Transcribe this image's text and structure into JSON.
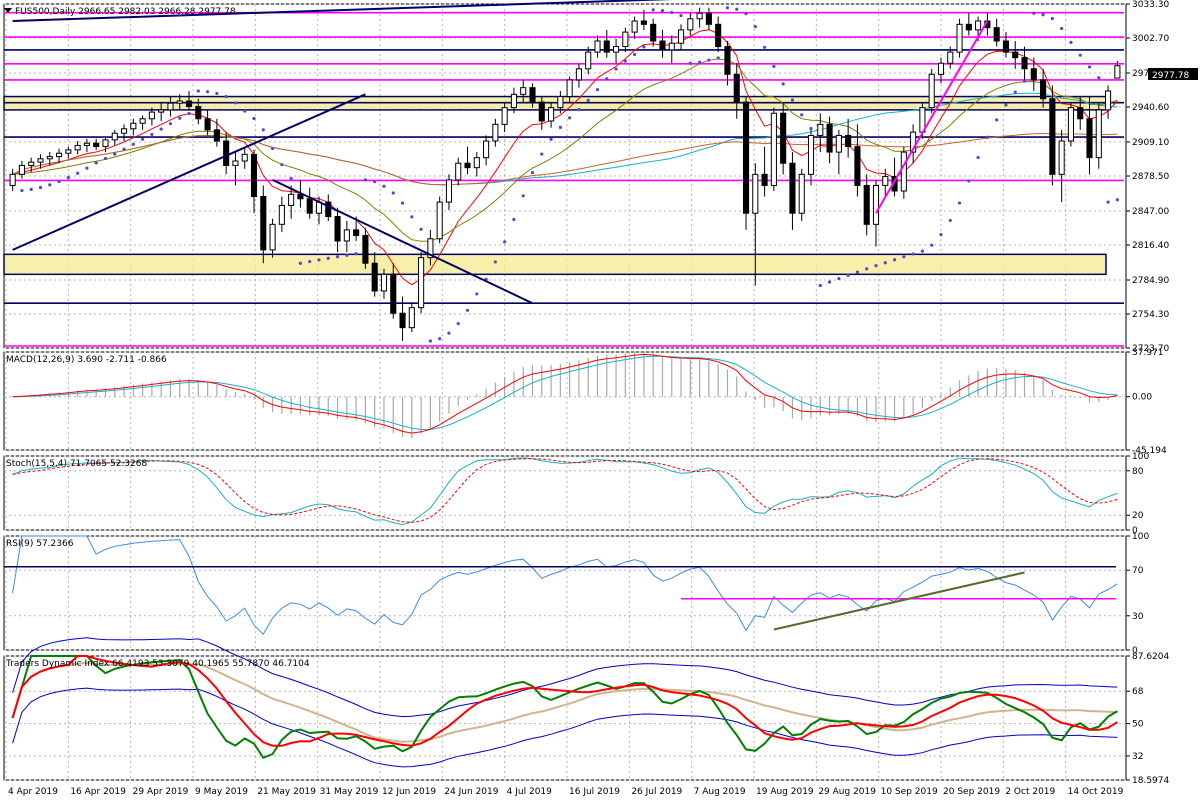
{
  "window": {
    "icon": "triangle-down-icon",
    "symbol_line": "FUS500,Daily  2966.65 2982.03 2966.28 2977.78",
    "last_price": "2977.78"
  },
  "colors": {
    "background": "#ffffff",
    "grid": "#b4b4b4",
    "candle": "#000000",
    "navy": "#000066",
    "magenta": "#ff00ff",
    "sar": "#4b4bd8",
    "zone": "#f5ea8e",
    "red": "#ff0000",
    "cyan": "#1ab0c8",
    "olive": "#808000",
    "tan": "#d2b48c",
    "green": "#008000",
    "blue": "#0000cc",
    "hist": "#a8a8a8",
    "price_box": "#000000"
  },
  "chart_data": [
    {
      "type": "candlestick",
      "title": "FUS500,Daily  2966.65 2982.03 2966.28 2977.78",
      "ylim": [
        2723.7,
        3033.3
      ],
      "y_ticks": [
        "3033.30",
        "3002.70",
        "2971.20",
        "2940.60",
        "2909.10",
        "2878.50",
        "2847.00",
        "2816.40",
        "2784.90",
        "2754.30",
        "2723.70"
      ],
      "x_labels": [
        "4 Apr 2019",
        "16 Apr 2019",
        "29 Apr 2019",
        "9 May 2019",
        "21 May 2019",
        "31 May 2019",
        "12 Jun 2019",
        "24 Jun 2019",
        "4 Jul 2019",
        "16 Jul 2019",
        "26 Jul 2019",
        "7 Aug 2019",
        "19 Aug 2019",
        "29 Aug 2019",
        "10 Sep 2019",
        "20 Sep 2019",
        "2 Oct 2019",
        "14 Oct 2019"
      ],
      "last_close": 2977.78,
      "candles": [
        [
          2870,
          2885,
          2865,
          2880
        ],
        [
          2880,
          2892,
          2876,
          2888
        ],
        [
          2888,
          2895,
          2882,
          2891
        ],
        [
          2891,
          2898,
          2885,
          2894
        ],
        [
          2894,
          2900,
          2888,
          2896
        ],
        [
          2896,
          2903,
          2890,
          2899
        ],
        [
          2899,
          2905,
          2894,
          2902
        ],
        [
          2902,
          2910,
          2898,
          2906
        ],
        [
          2906,
          2912,
          2900,
          2908
        ],
        [
          2908,
          2912,
          2902,
          2905
        ],
        [
          2905,
          2914,
          2900,
          2911
        ],
        [
          2911,
          2920,
          2906,
          2917
        ],
        [
          2917,
          2925,
          2910,
          2921
        ],
        [
          2921,
          2930,
          2915,
          2926
        ],
        [
          2926,
          2933,
          2920,
          2930
        ],
        [
          2930,
          2940,
          2924,
          2936
        ],
        [
          2936,
          2945,
          2928,
          2938
        ],
        [
          2938,
          2950,
          2932,
          2944
        ],
        [
          2944,
          2952,
          2938,
          2946
        ],
        [
          2946,
          2955,
          2938,
          2941
        ],
        [
          2941,
          2948,
          2925,
          2930
        ],
        [
          2930,
          2938,
          2915,
          2920
        ],
        [
          2920,
          2930,
          2905,
          2910
        ],
        [
          2910,
          2918,
          2880,
          2888
        ],
        [
          2888,
          2900,
          2870,
          2892
        ],
        [
          2892,
          2905,
          2885,
          2898
        ],
        [
          2898,
          2902,
          2845,
          2860
        ],
        [
          2860,
          2870,
          2800,
          2812
        ],
        [
          2812,
          2840,
          2805,
          2835
        ],
        [
          2835,
          2860,
          2828,
          2852
        ],
        [
          2852,
          2870,
          2840,
          2862
        ],
        [
          2862,
          2875,
          2850,
          2858
        ],
        [
          2858,
          2868,
          2840,
          2845
        ],
        [
          2845,
          2860,
          2835,
          2855
        ],
        [
          2855,
          2862,
          2838,
          2842
        ],
        [
          2842,
          2850,
          2810,
          2820
        ],
        [
          2820,
          2838,
          2810,
          2830
        ],
        [
          2830,
          2842,
          2820,
          2825
        ],
        [
          2825,
          2832,
          2795,
          2800
        ],
        [
          2800,
          2810,
          2770,
          2775
        ],
        [
          2775,
          2795,
          2768,
          2790
        ],
        [
          2790,
          2800,
          2750,
          2755
        ],
        [
          2755,
          2770,
          2730,
          2742
        ],
        [
          2742,
          2765,
          2738,
          2760
        ],
        [
          2760,
          2810,
          2755,
          2805
        ],
        [
          2805,
          2830,
          2798,
          2822
        ],
        [
          2822,
          2860,
          2818,
          2855
        ],
        [
          2855,
          2880,
          2848,
          2875
        ],
        [
          2875,
          2895,
          2870,
          2890
        ],
        [
          2890,
          2905,
          2880,
          2886
        ],
        [
          2886,
          2900,
          2878,
          2895
        ],
        [
          2895,
          2915,
          2888,
          2910
        ],
        [
          2910,
          2930,
          2905,
          2925
        ],
        [
          2925,
          2945,
          2918,
          2940
        ],
        [
          2940,
          2958,
          2935,
          2952
        ],
        [
          2952,
          2965,
          2945,
          2958
        ],
        [
          2958,
          2962,
          2940,
          2945
        ],
        [
          2945,
          2950,
          2920,
          2928
        ],
        [
          2928,
          2945,
          2922,
          2940
        ],
        [
          2940,
          2955,
          2935,
          2950
        ],
        [
          2950,
          2968,
          2945,
          2965
        ],
        [
          2965,
          2980,
          2958,
          2975
        ],
        [
          2975,
          2995,
          2970,
          2990
        ],
        [
          2990,
          3005,
          2985,
          3000
        ],
        [
          3000,
          3010,
          2985,
          2990
        ],
        [
          2990,
          3002,
          2980,
          2995
        ],
        [
          2995,
          3012,
          2990,
          3008
        ],
        [
          3008,
          3022,
          3002,
          3018
        ],
        [
          3018,
          3028,
          3010,
          3015
        ],
        [
          3015,
          3020,
          2995,
          3000
        ],
        [
          3000,
          3010,
          2985,
          2992
        ],
        [
          2992,
          3005,
          2980,
          2998
        ],
        [
          2998,
          3015,
          2992,
          3010
        ],
        [
          3010,
          3025,
          3005,
          3020
        ],
        [
          3020,
          3030,
          3012,
          3025
        ],
        [
          3025,
          3030,
          3010,
          3015
        ],
        [
          3015,
          3022,
          2990,
          2995
        ],
        [
          2995,
          3000,
          2960,
          2970
        ],
        [
          2970,
          2980,
          2930,
          2945
        ],
        [
          2945,
          2950,
          2830,
          2845
        ],
        [
          2845,
          2890,
          2780,
          2880
        ],
        [
          2880,
          2905,
          2860,
          2870
        ],
        [
          2870,
          2940,
          2865,
          2935
        ],
        [
          2935,
          2945,
          2880,
          2890
        ],
        [
          2890,
          2900,
          2830,
          2845
        ],
        [
          2845,
          2885,
          2838,
          2880
        ],
        [
          2880,
          2920,
          2870,
          2915
        ],
        [
          2915,
          2935,
          2900,
          2925
        ],
        [
          2925,
          2932,
          2890,
          2900
        ],
        [
          2900,
          2920,
          2880,
          2915
        ],
        [
          2915,
          2930,
          2895,
          2905
        ],
        [
          2905,
          2925,
          2860,
          2870
        ],
        [
          2870,
          2880,
          2825,
          2835
        ],
        [
          2835,
          2875,
          2815,
          2870
        ],
        [
          2870,
          2885,
          2860,
          2878
        ],
        [
          2878,
          2895,
          2860,
          2865
        ],
        [
          2865,
          2905,
          2858,
          2900
        ],
        [
          2900,
          2925,
          2890,
          2918
        ],
        [
          2918,
          2945,
          2912,
          2940
        ],
        [
          2940,
          2975,
          2935,
          2970
        ],
        [
          2970,
          2985,
          2962,
          2980
        ],
        [
          2980,
          2995,
          2975,
          2990
        ],
        [
          2990,
          3020,
          2985,
          3015
        ],
        [
          3015,
          3025,
          3005,
          3010
        ],
        [
          3010,
          3022,
          3000,
          3018
        ],
        [
          3018,
          3025,
          3005,
          3012
        ],
        [
          3012,
          3020,
          2995,
          3000
        ],
        [
          3000,
          3008,
          2985,
          2990
        ],
        [
          2990,
          3000,
          2975,
          2985
        ],
        [
          2985,
          2995,
          2965,
          2975
        ],
        [
          2975,
          2985,
          2955,
          2965
        ],
        [
          2965,
          2975,
          2940,
          2948
        ],
        [
          2948,
          2960,
          2870,
          2880
        ],
        [
          2880,
          2920,
          2855,
          2910
        ],
        [
          2910,
          2945,
          2905,
          2940
        ],
        [
          2940,
          2950,
          2920,
          2930
        ],
        [
          2930,
          2950,
          2880,
          2895
        ],
        [
          2895,
          2945,
          2885,
          2938
        ],
        [
          2938,
          2960,
          2930,
          2955
        ],
        [
          2966.65,
          2982.03,
          2966.28,
          2977.78
        ]
      ],
      "horizontal_lines": [
        {
          "value": 3025.5,
          "color": "magenta",
          "name": "resistance-top"
        },
        {
          "value": 3003.5,
          "color": "magenta",
          "name": "resistance-2"
        },
        {
          "value": 2992,
          "color": "navy",
          "name": "resistance-3"
        },
        {
          "value": 2979.5,
          "color": "magenta",
          "name": "resistance-4"
        },
        {
          "value": 2965,
          "color": "magenta",
          "name": "resistance-5"
        },
        {
          "value": 2944.5,
          "color": "navy",
          "name": "support-1"
        },
        {
          "value": 2913.5,
          "color": "navy",
          "name": "support-2"
        },
        {
          "value": 2874.5,
          "color": "magenta",
          "name": "support-3"
        },
        {
          "value": 2764,
          "color": "navy",
          "name": "support-4"
        },
        {
          "value": 2725.5,
          "color": "magenta",
          "name": "support-5"
        }
      ],
      "zones": [
        {
          "from": 2790,
          "to": 2808,
          "color": "zone"
        },
        {
          "from": 2938,
          "to": 2950,
          "color": "zone"
        }
      ]
    },
    {
      "type": "line",
      "title": "MACD(12,26,9) 3.690 -2.711 -0.866",
      "ylim": [
        -45.194,
        37.971
      ],
      "y_ticks": [
        "37.971",
        "0.00",
        "-45.194"
      ]
    },
    {
      "type": "line",
      "title": "Stoch(15,5,4) 71.7065 52.3268",
      "ylim": [
        0,
        100
      ],
      "y_ticks": [
        "100",
        "80",
        "20",
        "0"
      ]
    },
    {
      "type": "line",
      "title": "RSI(9) 57.2366",
      "ylim": [
        0,
        100
      ],
      "y_ticks": [
        "100",
        "70",
        "30",
        "0"
      ]
    },
    {
      "type": "line",
      "title": "Traders Dynamic Index 66.4193 53.3079 40.1965 55.7870 46.7104",
      "ylim": [
        18.5974,
        87.6204
      ],
      "y_ticks": [
        "87.6204",
        "68",
        "50",
        "32",
        "18.5974"
      ]
    }
  ]
}
